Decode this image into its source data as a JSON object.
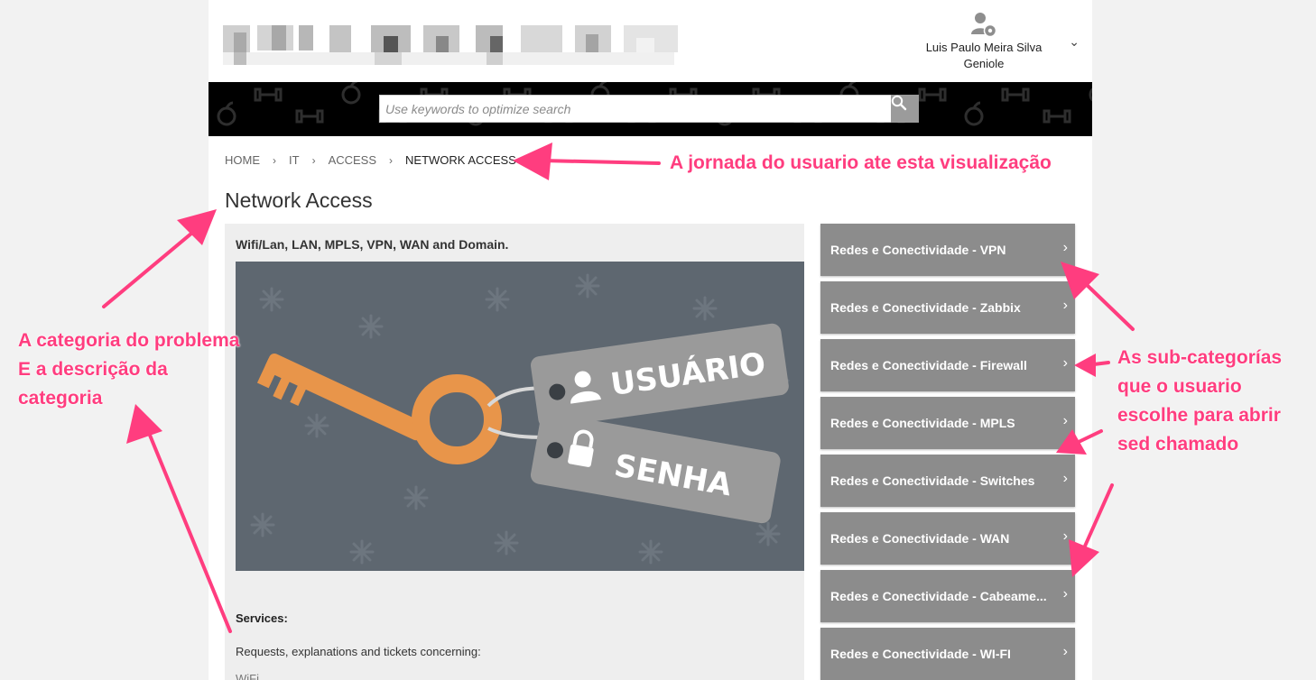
{
  "user": {
    "name": "Luis Paulo Meira Silva Geniole"
  },
  "icons": {
    "user": "user-gear-icon",
    "chevron": "chevron-down-icon",
    "search": "search-icon",
    "subcat_chevron": "chevron-right-icon"
  },
  "search": {
    "placeholder": "Use keywords to optimize search"
  },
  "breadcrumb": [
    "HOME",
    "IT",
    "ACCESS",
    "NETWORK ACCESS"
  ],
  "page_title": "Network Access",
  "category": {
    "description": "Wifi/Lan, LAN, MPLS, VPN, WAN and Domain.",
    "image": {
      "tag_user": "USUÁRIO",
      "tag_password": "SENHA"
    },
    "services_label": "Services:",
    "services_text": "Requests, explanations and tickets concerning:",
    "services_more": "WiFi"
  },
  "subcategories": [
    "Redes e Conectividade - VPN",
    "Redes e Conectividade - Zabbix",
    "Redes e Conectividade - Firewall",
    "Redes e Conectividade - MPLS",
    "Redes e Conectividade - Switches",
    "Redes e Conectividade - WAN",
    "Redes e Conectividade - Cabeame...",
    "Redes e Conectividade - WI-FI"
  ],
  "annotations": {
    "journey": "A jornada do usuario ate esta visualização",
    "category_lines": [
      "A categoria do problema",
      "E a descrição da",
      "categoria"
    ],
    "subcat_lines": [
      "As sub-categorías",
      "que o usuario",
      "escolhe para abrir",
      "sed chamado"
    ]
  },
  "colors": {
    "annotation": "#ff3d7f",
    "subcat_bg": "#8c8c8c",
    "banner": "#000000",
    "key": "#e8954a",
    "hero_bg": "#5e6770"
  }
}
